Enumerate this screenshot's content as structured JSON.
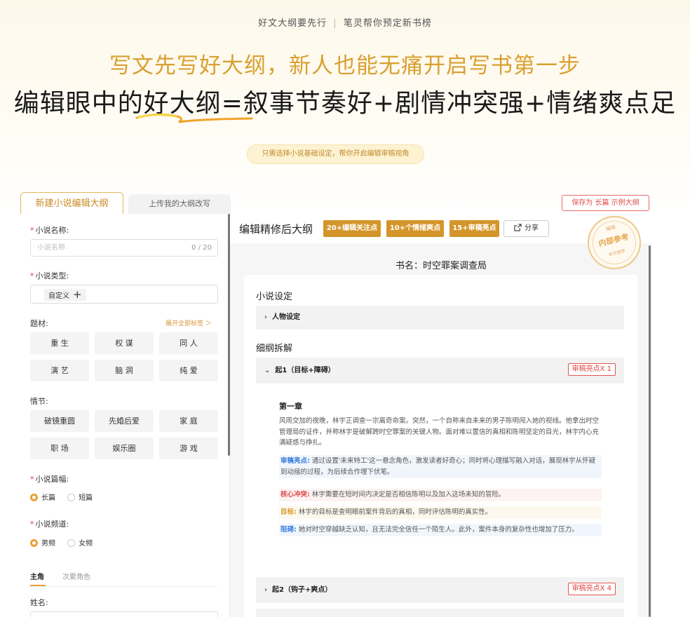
{
  "header": {
    "tagline_left": "好文大纲要先行",
    "tagline_sep": "|",
    "tagline_right": "笔灵帮你预定新书榜",
    "subtitle": "写文先写好大纲，新人也能无痛开启写书第一步",
    "main_title": "编辑眼中的好大纲=叙事节奏好+剧情冲突强+情绪爽点足",
    "pill": "只需选择小说基础设定，帮你开启编辑审稿视角"
  },
  "tabs": {
    "new": "新建小说编辑大纲",
    "upload": "上传我的大纲改写"
  },
  "save_button": "保存为 长篇 示例大纲",
  "form": {
    "name_label": "小说名称:",
    "name_placeholder": "小说名称",
    "name_count": "0 / 20",
    "type_label": "小说类型:",
    "type_tag": "自定义",
    "type_plus": "+",
    "theme_label": "题材:",
    "expand_all": "展开全部标签 ＞",
    "themes": [
      "重 生",
      "权 谋",
      "同 人",
      "演 艺",
      "脑 洞",
      "纯 爱"
    ],
    "plot_label": "情节:",
    "plots": [
      "破镜重圆",
      "先婚后爱",
      "家 庭",
      "职 场",
      "娱乐圈",
      "游 戏"
    ],
    "length_label": "小说篇幅:",
    "length_options": [
      "长篇",
      "短篇"
    ],
    "length_selected": "长篇",
    "channel_label": "小说频道:",
    "channel_options": [
      "男频",
      "女频"
    ],
    "channel_selected": "男频",
    "role_tabs": [
      "主角",
      "次要角色"
    ],
    "role_selected": "主角",
    "surname_label": "姓名:"
  },
  "editor": {
    "title": "编辑精修后大纲",
    "badges": [
      "20+编辑关注点",
      "10+个情绪爽点",
      "15+审稿亮点"
    ],
    "share": "分享",
    "stamp": {
      "top": "编辑",
      "middle": "内部参考",
      "bottom": "本月推荐"
    },
    "book_name": "书名：时空罪案调查局",
    "setting_title": "小说设定",
    "character_row": "人物设定",
    "outline_title": "细纲拆解",
    "sections": [
      {
        "title": "起1（目标+障碍）",
        "tag": "审稿亮点X 1",
        "expanded": true
      },
      {
        "title": "起2（钩子+爽点）",
        "tag": "审稿亮点X 4",
        "expanded": false
      }
    ],
    "chapter": {
      "title": "第一章",
      "body": "风雨交加的夜晚，林宇正调查一宗离奇命案。突然，一个自称来自未来的男子陈明闯入她的视线。他拿出时空管理局的证件，并称林宇是破解跨时空罪案的关键人物。面对难以置信的真相和陈明坚定的目光，林宇内心充满疑惑与挣扎。",
      "notes": [
        {
          "key": "审稿亮点:",
          "text": "通过设置'未来特工'这一悬念角色，激发读者好奇心；同时将心理描写融入对话，展现林宇从怀疑到动摇的过程，为后续合作埋下伏笔。"
        },
        {
          "key": "核心冲突:",
          "text": "林宇需要在短时间内决定是否相信陈明以及加入这场未知的冒险。"
        },
        {
          "key": "目标:",
          "text": "林宇的目标是查明眼前案件背后的真相，同时评估陈明的真实性。"
        },
        {
          "key": "阻碍:",
          "text": "她对时空穿越缺乏认知，且无法完全信任一个陌生人。此外，案件本身的复杂性也增加了压力。"
        }
      ]
    }
  },
  "colors": {
    "accent_gold": "#d4952a",
    "subtitle_gold": "#d9a030",
    "tag_red": "#e04040",
    "note_blue": "#3d7fdc"
  }
}
